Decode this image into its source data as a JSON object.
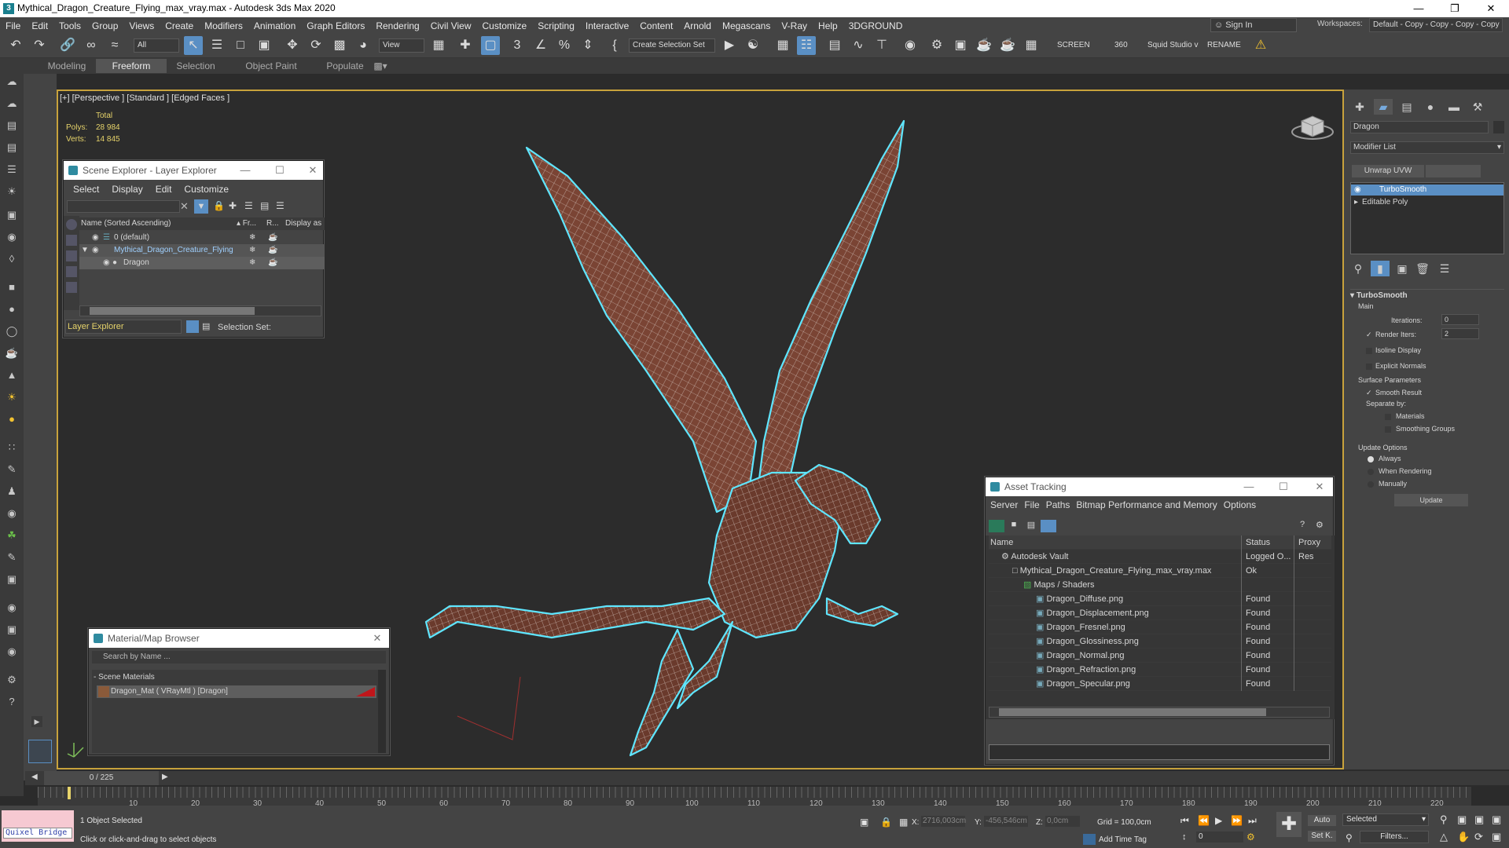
{
  "window": {
    "title": "Mythical_Dragon_Creature_Flying_max_vray.max - Autodesk 3ds Max 2020",
    "logo_text": "3"
  },
  "menubar": {
    "items": [
      "File",
      "Edit",
      "Tools",
      "Group",
      "Views",
      "Create",
      "Modifiers",
      "Animation",
      "Graph Editors",
      "Rendering",
      "Civil View",
      "Customize",
      "Scripting",
      "Interactive",
      "Content",
      "Arnold",
      "Megascans",
      "V-Ray",
      "Help",
      "3DGROUND"
    ],
    "signin": "Sign In",
    "workspaces_label": "Workspaces:",
    "workspace_value": "Default - Copy - Copy - Copy - Copy"
  },
  "toolbar": {
    "filter": "All",
    "ref_coord": "View",
    "selection_set": "Create Selection Set",
    "screen": "SCREEN",
    "n360": "360",
    "squid": "Squid Studio v",
    "rename": "RENAME"
  },
  "ribbon": {
    "tabs": [
      "Modeling",
      "Freeform",
      "Selection",
      "Object Paint",
      "Populate"
    ],
    "active": "Freeform"
  },
  "viewport": {
    "label": "[+] [Perspective ] [Standard ] [Edged Faces ]",
    "stats": {
      "total": "Total",
      "polys_label": "Polys:",
      "polys": "28 984",
      "verts_label": "Verts:",
      "verts": "14 845"
    },
    "colors": {
      "wire": "#e8e0dc",
      "mesh": "#7a4434",
      "outline": "#5fe6ff"
    }
  },
  "scene_explorer": {
    "title": "Scene Explorer - Layer Explorer",
    "menu": [
      "Select",
      "Display",
      "Edit",
      "Customize"
    ],
    "columns": [
      "Name (Sorted Ascending)",
      "▴ Fr...",
      "R...",
      "Display as"
    ],
    "rows": [
      {
        "name": "0 (default)"
      },
      {
        "name": "Mythical_Dragon_Creature_Flying"
      },
      {
        "name": "Dragon"
      }
    ],
    "footer_left": "Layer Explorer",
    "footer_right": "Selection Set:"
  },
  "material_browser": {
    "title": "Material/Map Browser",
    "search_placeholder": "Search by Name ...",
    "section": "- Scene Materials",
    "material": "Dragon_Mat  ( VRayMtl )  [Dragon]"
  },
  "asset_tracking": {
    "title": "Asset Tracking",
    "menu": [
      "Server",
      "File",
      "Paths",
      "Bitmap Performance and Memory",
      "Options"
    ],
    "columns": [
      "Name",
      "Status",
      "Proxy Res"
    ],
    "rows": [
      {
        "name": "Autodesk Vault",
        "status": "Logged O..."
      },
      {
        "name": "Mythical_Dragon_Creature_Flying_max_vray.max",
        "status": "Ok"
      },
      {
        "name": "Maps / Shaders",
        "status": ""
      },
      {
        "name": "Dragon_Diffuse.png",
        "status": "Found"
      },
      {
        "name": "Dragon_Displacement.png",
        "status": "Found"
      },
      {
        "name": "Dragon_Fresnel.png",
        "status": "Found"
      },
      {
        "name": "Dragon_Glossiness.png",
        "status": "Found"
      },
      {
        "name": "Dragon_Normal.png",
        "status": "Found"
      },
      {
        "name": "Dragon_Refraction.png",
        "status": "Found"
      },
      {
        "name": "Dragon_Specular.png",
        "status": "Found"
      }
    ]
  },
  "command_panel": {
    "object_name": "Dragon",
    "modifier_list": "Modifier List",
    "unwrap": "Unwrap UVW",
    "stack": [
      "TurboSmooth",
      "Editable Poly"
    ],
    "rollout": "TurboSmooth",
    "main": "Main",
    "iterations_label": "Iterations:",
    "iterations": "0",
    "render_iters_label": "Render Iters:",
    "render_iters": "2",
    "isoline": "Isoline Display",
    "explicit_normals": "Explicit Normals",
    "surface_params": "Surface Parameters",
    "smooth_result": "Smooth Result",
    "separate_by": "Separate by:",
    "materials": "Materials",
    "smoothing_groups": "Smoothing Groups",
    "update_options": "Update Options",
    "always": "Always",
    "when_rendering": "When Rendering",
    "manually": "Manually",
    "update": "Update"
  },
  "timeline": {
    "frame": "0 / 225",
    "ticks": [
      "10",
      "20",
      "30",
      "40",
      "50",
      "60",
      "70",
      "80",
      "90",
      "100",
      "110",
      "120",
      "130",
      "140",
      "150",
      "160",
      "170",
      "180",
      "190",
      "200",
      "210",
      "220"
    ]
  },
  "status": {
    "quixel": "Quixel Bridge",
    "selected": "1 Object Selected",
    "hint": "Click or click-and-drag to select objects",
    "x_label": "X:",
    "x": "2716,003cm",
    "y_label": "Y:",
    "y": "-456,546cm",
    "z_label": "Z:",
    "z": "0,0cm",
    "grid": "Grid = 100,0cm",
    "add_time_tag": "Add Time Tag",
    "auto": "Auto",
    "selected_dd": "Selected",
    "set_k": "Set K.",
    "filters": "Filters...",
    "frame_field": "0"
  }
}
